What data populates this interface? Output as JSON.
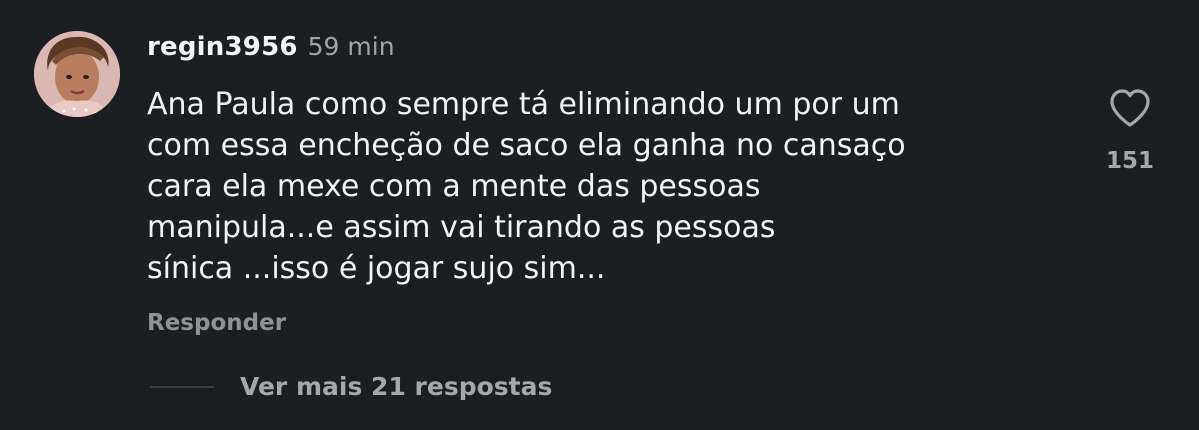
{
  "comment": {
    "username": "regin3956",
    "timestamp": "59 min",
    "text_lines": [
      "Ana Paula como sempre tá eliminando um por um",
      "com essa encheção de saco ela ganha no cansaço",
      "cara ela mexe com a mente das pessoas",
      "manipula...e assim vai tirando as pessoas",
      "sínica ...isso é jogar sujo sim..."
    ],
    "reply_label": "Responder",
    "like_count": "151",
    "view_replies_label": "Ver mais 21 respostas"
  },
  "icons": {
    "like": "heart-outline-icon",
    "avatar": "profile-photo"
  },
  "colors": {
    "background": "#1c1f22",
    "text_primary": "#f2f2f2",
    "text_secondary": "#a0a4a8"
  }
}
